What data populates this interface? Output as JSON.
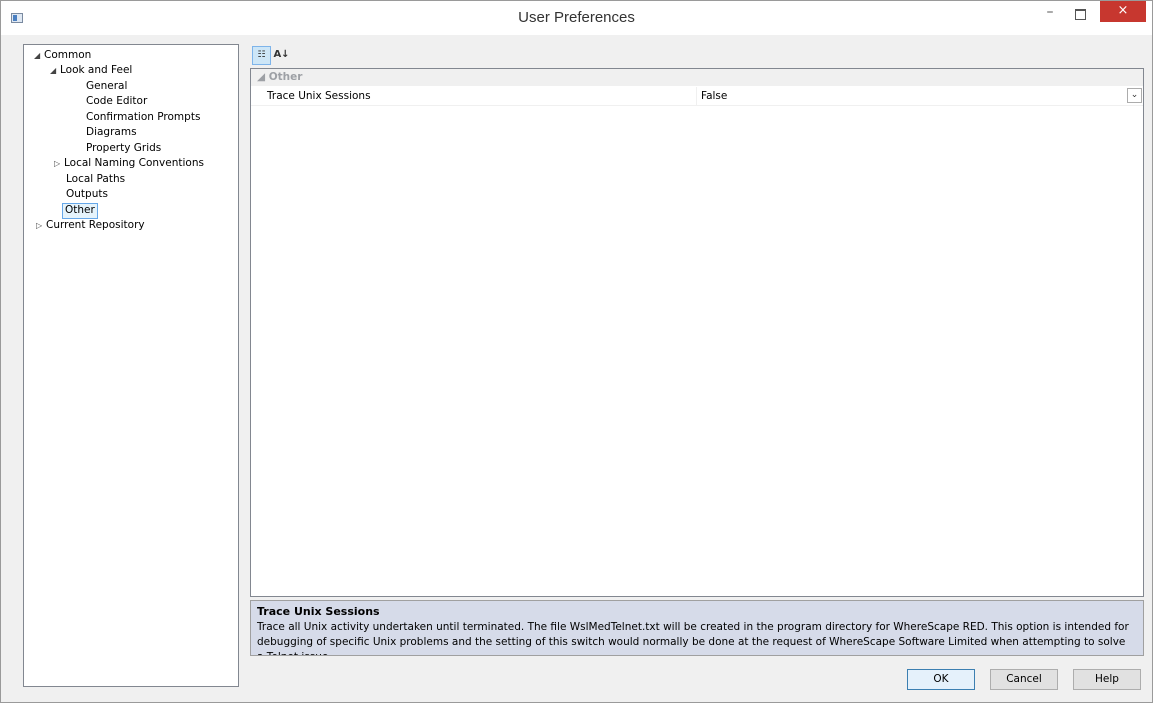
{
  "window": {
    "title": "User Preferences",
    "minimize_glyph": "–",
    "close_glyph": "×"
  },
  "tree": {
    "common": "Common",
    "look_and_feel": "Look and Feel",
    "general": "General",
    "code_editor": "Code Editor",
    "confirmation_prompts": "Confirmation Prompts",
    "diagrams": "Diagrams",
    "property_grids": "Property Grids",
    "local_naming_conventions": "Local Naming Conventions",
    "local_paths": "Local Paths",
    "outputs": "Outputs",
    "other": "Other",
    "current_repository": "Current Repository",
    "selected": "Other"
  },
  "toolbar": {
    "categorized_icon": "categorized-view-icon",
    "alphabetical_icon": "sort-alphabetical-icon"
  },
  "grid": {
    "category": "Other",
    "properties": [
      {
        "name": "Trace Unix Sessions",
        "value": "False"
      }
    ]
  },
  "description": {
    "title": "Trace Unix Sessions",
    "text": "Trace all Unix activity undertaken until terminated. The file WslMedTelnet.txt will be created in the program directory for WhereScape RED. This option is intended for debugging of specific Unix problems and the setting of this switch would normally be done at the request of WhereScape Software Limited when attempting to solve a Telnet issue."
  },
  "buttons": {
    "ok": "OK",
    "cancel": "Cancel",
    "help": "Help"
  },
  "colors": {
    "close_button": "#c7372f",
    "selection_border": "#66a7e8",
    "description_background": "#d6dbe9"
  }
}
